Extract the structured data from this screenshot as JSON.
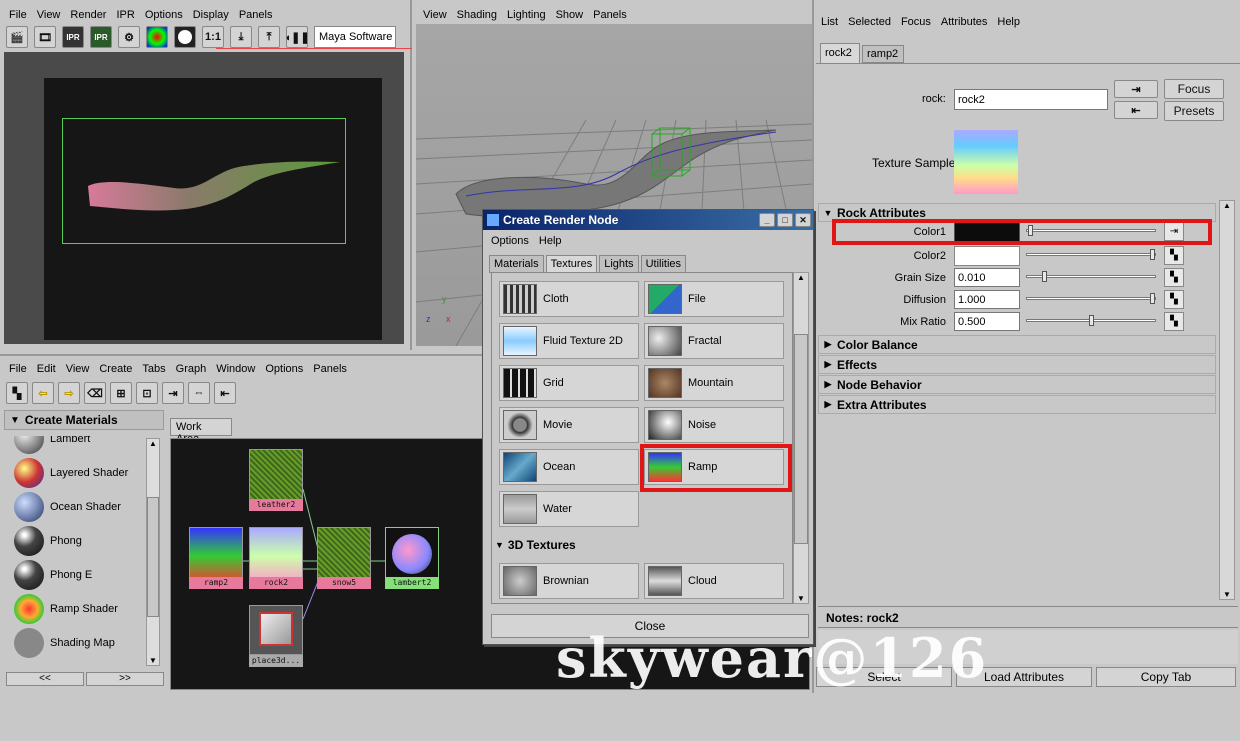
{
  "render_view": {
    "menu": [
      "File",
      "View",
      "Render",
      "IPR",
      "Options",
      "Display",
      "Panels"
    ],
    "renderer": "Maya Software",
    "ratio": "1:1",
    "ipr_a": "IPR",
    "ipr_b": "IPR"
  },
  "persp_view": {
    "menu": [
      "View",
      "Shading",
      "Lighting",
      "Show",
      "Panels"
    ],
    "axis_y": "y",
    "axis_z": "z",
    "axis_x": "x"
  },
  "hypershade": {
    "menu": [
      "File",
      "Edit",
      "View",
      "Create",
      "Tabs",
      "Graph",
      "Window",
      "Options",
      "Panels"
    ],
    "create_bar": "Create Materials",
    "work_tab": "Work Area",
    "materials": [
      "Lambert",
      "Layered Shader",
      "Ocean Shader",
      "Phong",
      "Phong E",
      "Ramp Shader",
      "Shading Map"
    ],
    "pager_left": "<<",
    "pager_right": ">>",
    "nodes": {
      "leather": "leather2",
      "ramp": "ramp2",
      "rock": "rock2",
      "snow": "snow5",
      "lambert": "lambert2",
      "place": "place3d..."
    }
  },
  "dialog": {
    "title": "Create Render Node",
    "menu": [
      "Options",
      "Help"
    ],
    "tabs": [
      "Materials",
      "Textures",
      "Lights",
      "Utilities"
    ],
    "active_tab": "Textures",
    "textures_2d": [
      "Cloth",
      "File",
      "Fluid Texture 2D",
      "Fractal",
      "Grid",
      "Mountain",
      "Movie",
      "Noise",
      "Ocean",
      "Ramp",
      "Water"
    ],
    "section_3d": "3D Textures",
    "textures_3d": [
      "Brownian",
      "Cloud"
    ],
    "close": "Close"
  },
  "attr_editor": {
    "menu": [
      "List",
      "Selected",
      "Focus",
      "Attributes",
      "Help"
    ],
    "tabs": [
      "rock2",
      "ramp2"
    ],
    "node_label": "rock:",
    "node_name": "rock2",
    "focus": "Focus",
    "presets": "Presets",
    "sample_label": "Texture Sample",
    "section": "Rock Attributes",
    "attrs": [
      {
        "label": "Color1",
        "value": ""
      },
      {
        "label": "Color2",
        "value": ""
      },
      {
        "label": "Grain Size",
        "value": "0.010"
      },
      {
        "label": "Diffusion",
        "value": "1.000"
      },
      {
        "label": "Mix Ratio",
        "value": "0.500"
      }
    ],
    "collapsed": [
      "Color Balance",
      "Effects",
      "Node Behavior",
      "Extra Attributes"
    ],
    "notes": "Notes: rock2",
    "btn_select": "Select",
    "btn_load": "Load Attributes",
    "btn_copy": "Copy Tab"
  },
  "watermark": "skywear@126",
  "colors": {
    "highlight": "#e01515",
    "title_bar": "#0a246a",
    "node_pink": "#e77a9c",
    "node_green": "#86e07a"
  }
}
